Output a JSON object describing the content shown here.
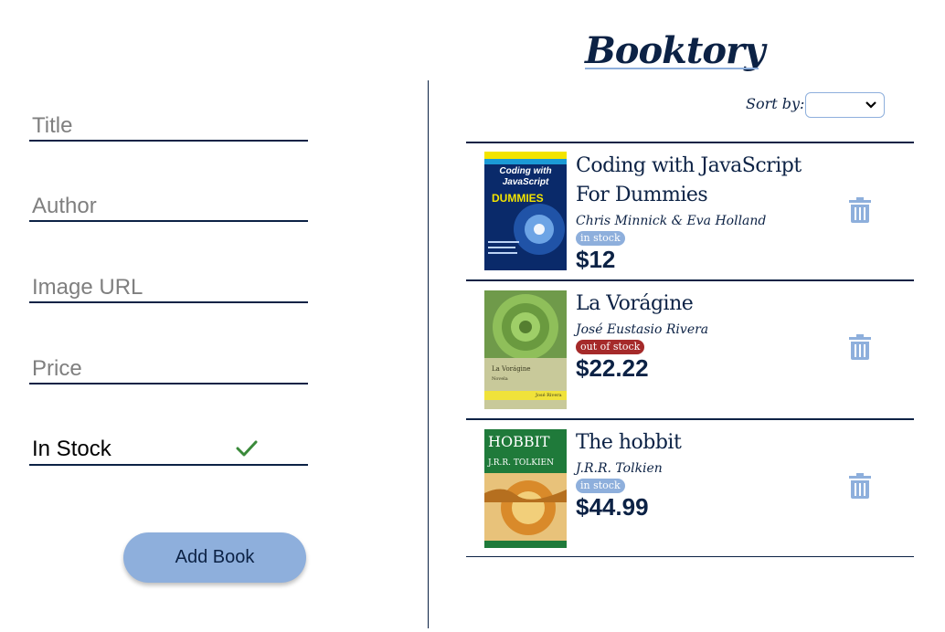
{
  "app": {
    "title": "Booktory"
  },
  "form": {
    "title_placeholder": "Title",
    "author_placeholder": "Author",
    "image_placeholder": "Image URL",
    "price_placeholder": "Price",
    "in_stock_label": "In Stock",
    "in_stock_checked": true,
    "submit_label": "Add Book"
  },
  "sort": {
    "label": "Sort by:",
    "selected": ""
  },
  "books": [
    {
      "title": "Coding with JavaScript For Dummies",
      "author": "Chris Minnick & Eva Holland",
      "status": "in stock",
      "price": "$12",
      "cover_text": {
        "line1": "Coding with",
        "line2": "JavaScript",
        "brand": "DUMMIES"
      }
    },
    {
      "title": "La Vorágine",
      "author": "José Eustasio Rivera",
      "status": "out of stock",
      "price": "$22.22",
      "cover_text": {
        "line1": "La Vorágine",
        "line2": "Novela",
        "brand": "José Rivera"
      }
    },
    {
      "title": "The hobbit",
      "author": "J.R.R. Tolkien",
      "status": "in stock",
      "price": "$44.99",
      "cover_text": {
        "line1": "HOBBIT",
        "line2": "J.R.R. TOLKIEN",
        "brand": ""
      }
    }
  ],
  "colors": {
    "navy": "#0c2245",
    "accent": "#8eafdc",
    "out_of_stock": "#a52a2a",
    "check": "#3a8a3a"
  },
  "icons": [
    "check-icon",
    "chevron-down-icon",
    "trash-icon"
  ]
}
